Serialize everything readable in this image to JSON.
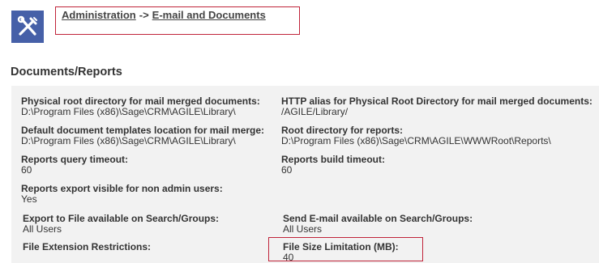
{
  "breadcrumb": {
    "root": "Administration",
    "separator": "->",
    "current": "E-mail and Documents"
  },
  "header_icon": "tools-icon",
  "section_title": "Documents/Reports",
  "fields": {
    "physical_root": {
      "label": "Physical root directory for mail merged documents:",
      "value": "D:\\Program Files (x86)\\Sage\\CRM\\AGILE\\Library\\"
    },
    "http_alias": {
      "label": "HTTP alias for Physical Root Directory for mail merged documents:",
      "value": "/AGILE/Library/"
    },
    "default_templates": {
      "label": "Default document templates location for mail merge:",
      "value": "D:\\Program Files (x86)\\Sage\\CRM\\AGILE\\Library\\"
    },
    "root_reports": {
      "label": "Root directory for reports:",
      "value": "D:\\Program Files (x86)\\Sage\\CRM\\AGILE\\WWWRoot\\Reports\\"
    },
    "query_timeout": {
      "label": "Reports query timeout:",
      "value": "60"
    },
    "build_timeout": {
      "label": "Reports build timeout:",
      "value": "60"
    },
    "export_visible": {
      "label": "Reports export visible for non admin users:",
      "value": "Yes"
    },
    "export_search": {
      "label": "Export to File available on Search/Groups:",
      "value": "All Users"
    },
    "send_email": {
      "label": "Send E-mail available on Search/Groups:",
      "value": "All Users"
    },
    "file_ext": {
      "label": "File Extension Restrictions:",
      "value": ""
    },
    "file_size": {
      "label": "File Size Limitation (MB):",
      "value": "40"
    }
  },
  "colors": {
    "icon_bg": "#4660a8",
    "highlight_border": "#c0243a",
    "panel_bg": "#f2f2f2"
  }
}
